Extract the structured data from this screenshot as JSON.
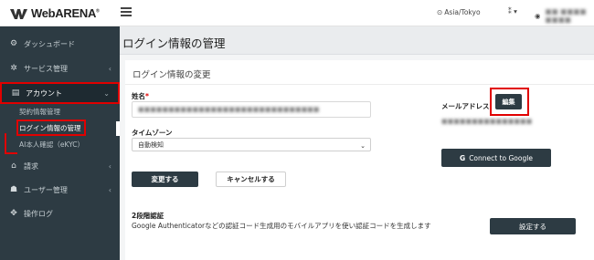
{
  "header": {
    "logo_text": "WebARENA",
    "logo_mark": "®",
    "timezone": "Asia/Tokyo",
    "language_icon": "translate-icon",
    "language_caret": "▾",
    "user_name": "■■ ■■■■ ■■■■"
  },
  "sidebar": {
    "items": [
      {
        "label": "ダッシュボード",
        "icon": "dashboard-icon",
        "glyph": "⚙"
      },
      {
        "label": "サービス管理",
        "icon": "services-icon",
        "glyph": "✲",
        "chevron": "‹"
      },
      {
        "label": "アカウント",
        "icon": "account-card-icon",
        "glyph": "▤",
        "chevron": "⌄"
      },
      {
        "label": "請求",
        "icon": "billing-icon",
        "glyph": "⌂",
        "chevron": "‹"
      },
      {
        "label": "ユーザー管理",
        "icon": "users-icon",
        "glyph": "☗",
        "chevron": "‹"
      },
      {
        "label": "操作ログ",
        "icon": "log-icon",
        "glyph": "✥"
      }
    ],
    "sub_items": [
      {
        "label": "契約情報管理"
      },
      {
        "label": "ログイン情報の管理"
      },
      {
        "label": "AI本人確認（eKYC）"
      }
    ]
  },
  "main": {
    "page_title": "ログイン情報の管理",
    "card_title": "ログイン情報の変更",
    "name_label": "姓名",
    "required_mark": "*",
    "name_value": "■■■■■■■■■■■■■■■■■■■■■■■■■■■■■■",
    "timezone_label": "タイムゾーン",
    "timezone_value": "自動検知",
    "email_label": "メールアドレス",
    "edit_button": "編集",
    "email_value": "■■■■■■■■■■■■■■■",
    "change_button": "変更する",
    "cancel_button": "キャンセルする",
    "google_button": "Connect to Google",
    "google_glyph": "G",
    "twofa_title": "2段階認証",
    "twofa_description": "Google Authenticatorなどの認証コード生成用のモバイルアプリを使い認証コードを生成します",
    "twofa_button": "設定する"
  },
  "colors": {
    "sidebar_bg": "#2d3b43",
    "highlight_red": "#e10000",
    "button_dark": "#2d3b43"
  }
}
